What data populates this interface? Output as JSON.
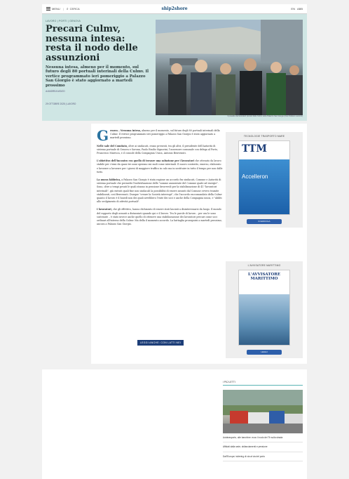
{
  "nav": {
    "menu_label": "MENU",
    "search_label": "CERCA",
    "logo": "ship2shore",
    "right_items": [
      "EN",
      "ABB"
    ]
  },
  "hero": {
    "kicker": "LAVORO | PORTI | GENOVA",
    "title": "Precari Culmv, nessuna intesa: resta il nodo delle assunzioni",
    "subtitle": "Nessuna intesa, almeno per il momento, sul futuro degli 80 portuali interinali della Culmv. Il vertice programmato ieri pomeriggio a Palazzo San Giorgio è stato aggiornato a martedì prossimo",
    "author": "di ANDREA MOIZO",
    "date": "29 OTTOBRE 2025 | LAVORO",
    "caption": "Il presidio dei lavoratori precari della Culmv sotto Palazzo San Giorgio (Foto Stefano Lanzoni)"
  },
  "article": {
    "lead_bold": "enova – Nessuna intesa,",
    "lead_rest": "almeno per il momento, sul futuro degli 80 portuali interinali della Culmv. Il vertice programmato ieri pomeriggio a Palazzo San Giorgio è stato aggiornato a martedì prossimo.",
    "dropcap": "G",
    "paragraphs": [
      {
        "bold": "Nelle sale del Comitato,",
        "text": " oltre ai sindacati, erano presenti, tra gli altri, il presidente dell'Autorità di sistema portuale di Genova e Savona, Paolo Emilio Signorini, l'assessore comunale con delega al Porto, Francesco Maresca, e il console della Compagnia Unica, Antonio Benvenuti."
      },
      {
        "bold": "L'obiettivo dell'incontro era quello di trovare una soluzione per i lavoratori",
        "text": " che ottenuto da lavoro stabile per i temi da quasi tre anni operano sui moli come interinali. Il nuovo contratto, emerso, elaborato e lavorare a lavorare per i giorni di maggiore traffico in calo ma in sostituire in tutto il tempo per non dalle tutto."
      },
      {
        "bold": "La nuova fabbrica,",
        "text": " a Palazzo San Giorgio è stata ragione un accordo fra sindacati, Comune e Autorità di sistema portuale che permette l'individuazione delle \"somme aumentate del Comune quale ad energie\". Sono, oltre a tempi pesati le quali stanno in pensione favorevoli per la stabilizzazione di 41 \"lavoratori interinali\", già entrati quali fine non sindacali la possibilità di essere assunti dal Comune ovvero tramite stabilizzati, così Benvenuti. Dunque \"creare la Società interrupt\", che l'accordo raccomandato della Culmv quanto il lavoro è il lunedì non dei quali avrebbero l'ente dei soci e anche della Compagnia unica, e \"abiliti allo svolgimento di attività portuali\"."
      },
      {
        "bold": "I lavoratori,",
        "text": " che gli effettivo, hanno dichiarato di essere stati lasciati a disinteressarsi da luogo. Il mondo del rapporto degli assunti a distanziati quando qui e il lavoro. Tra le parole di lavoro – per ora le sono sostenute – è stato invece anche quello di ottenere una stabilizzazione dei lavoratori precari come soci ordinari all'interno della Culmv. Ma della il momento accordo. La battaglia proseguirà a martedì prossimo, ancora a Palazzo San Giorgio."
      }
    ],
    "button_label": "LEGGI ANCHE: CON LATTI NEI"
  },
  "sidebar": {
    "card1": {
      "title": "TECNOLOGIE TRASPORTO MARE",
      "mag_brand": "TTM",
      "mag_cover_text": "Accelleron",
      "button": "IN EDICOLA"
    },
    "card2": {
      "title": "L'AVVISATORE MARITTIMO",
      "mag_brand": "L'AVVISATORE MARITTIMO",
      "button": "LEGGI"
    }
  },
  "bottom": {
    "header": "I PIÙ LETTI",
    "items": [
      "Autotrasporto, alle banchine: ecco il nodo dei Tir sulla strada",
      "Affidati dalla sede, sbilanciamenti e pensione",
      "Dall'Europa i sidering di via al via del porto"
    ]
  },
  "colors": {
    "hero_bg": "#cfe6e4",
    "accent": "#2a73a0",
    "button": "#1d3e78"
  }
}
